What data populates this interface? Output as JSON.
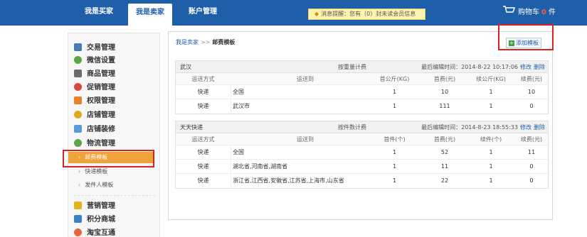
{
  "topnav": {
    "tabs": [
      {
        "label": "我是买家"
      },
      {
        "label": "我是卖家"
      },
      {
        "label": "账户管理"
      }
    ],
    "notice": {
      "prefix": "消息提醒：您有（",
      "count": "0",
      "suffix": "）封未读会员信息"
    },
    "cart": {
      "label": "购物车",
      "count": "0",
      "unit": "件"
    }
  },
  "sidebar": {
    "items": [
      {
        "label": "交易管理",
        "icon": "trade-icon",
        "color": "#4a7ab8"
      },
      {
        "label": "微信设置",
        "icon": "wechat-icon",
        "color": "#5aa646"
      },
      {
        "label": "商品管理",
        "icon": "goods-icon",
        "color": "#6b6b6b"
      },
      {
        "label": "促销管理",
        "icon": "promo-icon",
        "color": "#d9473a"
      },
      {
        "label": "权限管理",
        "icon": "permission-icon",
        "color": "#e8822a"
      },
      {
        "label": "店铺管理",
        "icon": "store-icon",
        "color": "#e0a81f"
      },
      {
        "label": "店铺装修",
        "icon": "decor-icon",
        "color": "#5a9ad6"
      },
      {
        "label": "物流管理",
        "icon": "logistics-icon",
        "color": "#5aa646"
      },
      {
        "label": "营销管理",
        "icon": "star-icon",
        "color": "#e8b21f"
      },
      {
        "label": "积分商城",
        "icon": "points-icon",
        "color": "#3a7fc8"
      },
      {
        "label": "淘宝互通",
        "icon": "taobao-icon",
        "color": "#e06a3a"
      }
    ],
    "sub_items": [
      {
        "label": "邮费模板"
      },
      {
        "label": "快递模板"
      },
      {
        "label": "发件人模板"
      }
    ]
  },
  "main": {
    "breadcrumb": {
      "root": "我是卖家",
      "sep": ">>",
      "current": "邮费模板"
    },
    "add_button": "添加模板",
    "templates": [
      {
        "name": "武汉",
        "calc": "按重量计费",
        "edited": "最后编辑时间：2014-8-22 10:17:06",
        "edit": "修改",
        "delete": "删除",
        "columns": [
          "运送方式",
          "运送到",
          "首公斤(KG)",
          "首费(元)",
          "续公斤(KG)",
          "续费(元)"
        ],
        "rows": [
          [
            "快递",
            "全国",
            "1",
            "10",
            "1",
            "10"
          ],
          [
            "快递",
            "武汉市",
            "1",
            "111",
            "1",
            "0"
          ]
        ]
      },
      {
        "name": "天天快递",
        "calc": "按件数计费",
        "edited": "最后编辑时间：2014-8-23 18:55:33",
        "edit": "修改",
        "delete": "删除",
        "columns": [
          "运送方式",
          "运送到",
          "首件(个)",
          "首费(元)",
          "续件(个)",
          "续费(元)"
        ],
        "rows": [
          [
            "快递",
            "全国",
            "1",
            "52",
            "1",
            "11"
          ],
          [
            "快递",
            "湖北省,河南省,湖南省",
            "1",
            "11",
            "1",
            "0"
          ],
          [
            "快递",
            "浙江省,江西省,安徽省,江苏省,上海市,山东省",
            "1",
            "22",
            "1",
            "0"
          ]
        ]
      }
    ]
  }
}
